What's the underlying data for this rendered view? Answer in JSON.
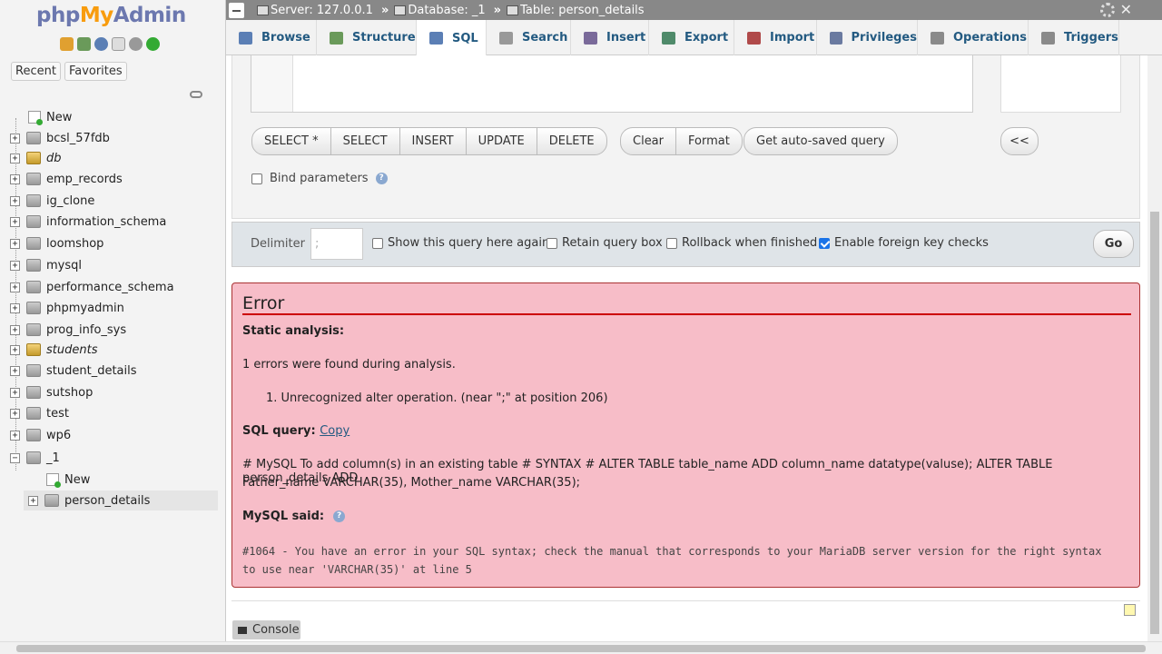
{
  "left_panel": {
    "logo": {
      "php": "php",
      "my": "My",
      "admin": "Admin"
    },
    "recent_label": "Recent",
    "favorites_label": "Favorites",
    "tree": [
      {
        "label": "New",
        "type": "new",
        "italic": false
      },
      {
        "label": "bcsl_57fdb",
        "type": "db",
        "italic": false
      },
      {
        "label": "db",
        "type": "db-gold",
        "italic": true
      },
      {
        "label": "emp_records",
        "type": "db",
        "italic": false
      },
      {
        "label": "ig_clone",
        "type": "db",
        "italic": false
      },
      {
        "label": "information_schema",
        "type": "db",
        "italic": false
      },
      {
        "label": "loomshop",
        "type": "db",
        "italic": false
      },
      {
        "label": "mysql",
        "type": "db",
        "italic": false
      },
      {
        "label": "performance_schema",
        "type": "db",
        "italic": false
      },
      {
        "label": "phpmyadmin",
        "type": "db",
        "italic": false
      },
      {
        "label": "prog_info_sys",
        "type": "db",
        "italic": false
      },
      {
        "label": "students",
        "type": "db-gold",
        "italic": true
      },
      {
        "label": "student_details",
        "type": "db",
        "italic": false
      },
      {
        "label": "sutshop",
        "type": "db",
        "italic": false
      },
      {
        "label": "test",
        "type": "db",
        "italic": false
      },
      {
        "label": "wp6",
        "type": "db",
        "italic": false
      },
      {
        "label": "_1",
        "type": "db-open",
        "italic": false
      },
      {
        "label": "New",
        "type": "sub-new",
        "italic": false
      },
      {
        "label": "person_details",
        "type": "sub-table",
        "italic": false
      }
    ]
  },
  "breadcrumb": {
    "server": "Server: 127.0.0.1",
    "database": "Database: _1",
    "table": "Table: person_details",
    "separator": "»"
  },
  "tabs": [
    {
      "label": "Browse",
      "color": "#5b7fb5"
    },
    {
      "label": "Structure",
      "color": "#6a9a5a"
    },
    {
      "label": "SQL",
      "color": "#5b7fb5"
    },
    {
      "label": "Search",
      "color": "#999999"
    },
    {
      "label": "Insert",
      "color": "#7a6a9a"
    },
    {
      "label": "Export",
      "color": "#4f8a6a"
    },
    {
      "label": "Import",
      "color": "#b04a4a"
    },
    {
      "label": "Privileges",
      "color": "#6a7aa0"
    },
    {
      "label": "Operations",
      "color": "#8a8a8a"
    },
    {
      "label": "Triggers",
      "color": "#8a8a8a"
    }
  ],
  "sql_buttons": {
    "group1": [
      "SELECT *",
      "SELECT",
      "INSERT",
      "UPDATE",
      "DELETE"
    ],
    "group2": [
      "Clear",
      "Format"
    ],
    "group3": [
      "Get auto-saved query"
    ],
    "collapse": "<<"
  },
  "bind_parameters": "Bind parameters",
  "footer": {
    "delimiter_label": "Delimiter",
    "delimiter_value": ";",
    "show_query": "Show this query here again",
    "retain_box": "Retain query box",
    "rollback": "Rollback when finished",
    "foreign_keys": "Enable foreign key checks",
    "go": "Go"
  },
  "error": {
    "title": "Error",
    "static_analysis": "Static analysis:",
    "errors_found": "1 errors were found during analysis.",
    "error_item": "1. Unrecognized alter operation. (near \";\" at position 206)",
    "sql_query_label": "SQL query:",
    "copy_link": "Copy",
    "query_line1": "# MySQL To add column(s) in an existing table # SYNTAX # ALTER TABLE table_name ADD column_name datatype(valuse); ALTER TABLE person_details ADD",
    "query_line2": "Father_name VARCHAR(35), Mother_name VARCHAR(35);",
    "mysql_said": "MySQL said:",
    "message_line1": "#1064 - You have an error in your SQL syntax; check the manual that corresponds to your MariaDB server version for the right syntax",
    "message_line2": "to use near 'VARCHAR(35)' at line 5"
  },
  "console_label": "Console",
  "colors": {
    "accent": "#235a81",
    "error_bg": "#f7bdc8",
    "error_rule": "#cc0000",
    "topbar": "#888888"
  }
}
